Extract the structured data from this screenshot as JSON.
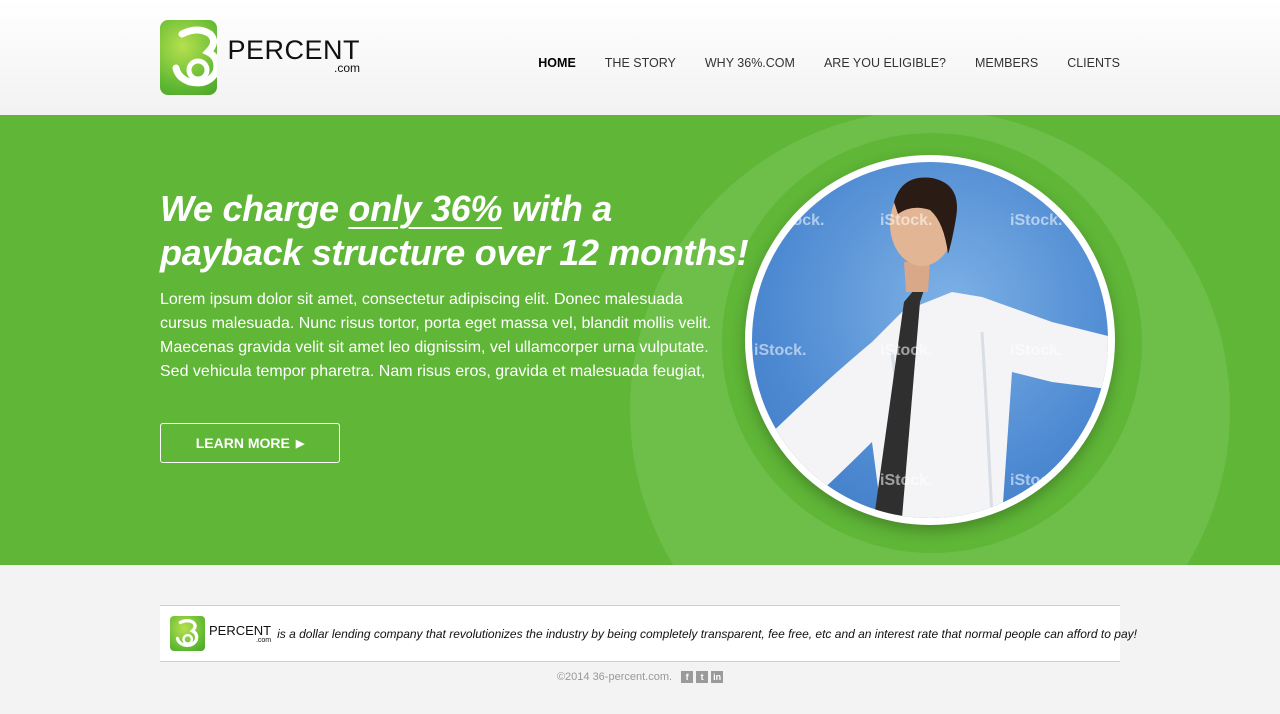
{
  "brand": {
    "word": "PERCENT",
    "domain": ".com",
    "number": "3",
    "accent": "#5fb637"
  },
  "nav": {
    "items": [
      "HOME",
      "THE STORY",
      "WHY 36%.COM",
      "ARE YOU ELIGIBLE?",
      "MEMBERS",
      "CLIENTS"
    ],
    "active": "HOME"
  },
  "hero": {
    "title_pre": "We charge ",
    "title_highlight": "only 36%",
    "title_post": " with a payback structure over 12 months!",
    "body": "Lorem ipsum dolor sit amet, consectetur adipiscing elit. Donec malesuada cursus malesuada. Nunc risus tortor, porta eget massa vel, blandit mollis velit. Maecenas gravida velit sit amet leo dignissim, vel ullamcorper urna vulputate. Sed vehicula tempor pharetra. Nam risus eros, gravida et malesuada feugiat,",
    "button_label": "LEARN MORE",
    "watermark": "iStock."
  },
  "footer": {
    "tagline": "is a dollar lending company that revolutionizes the industry by being completely transparent, fee  free, etc and an interest rate that normal people can afford to pay!",
    "copyright": "©2014 36-percent.com.",
    "social_icons": [
      "facebook-icon",
      "twitter-icon",
      "linkedin-icon"
    ]
  }
}
